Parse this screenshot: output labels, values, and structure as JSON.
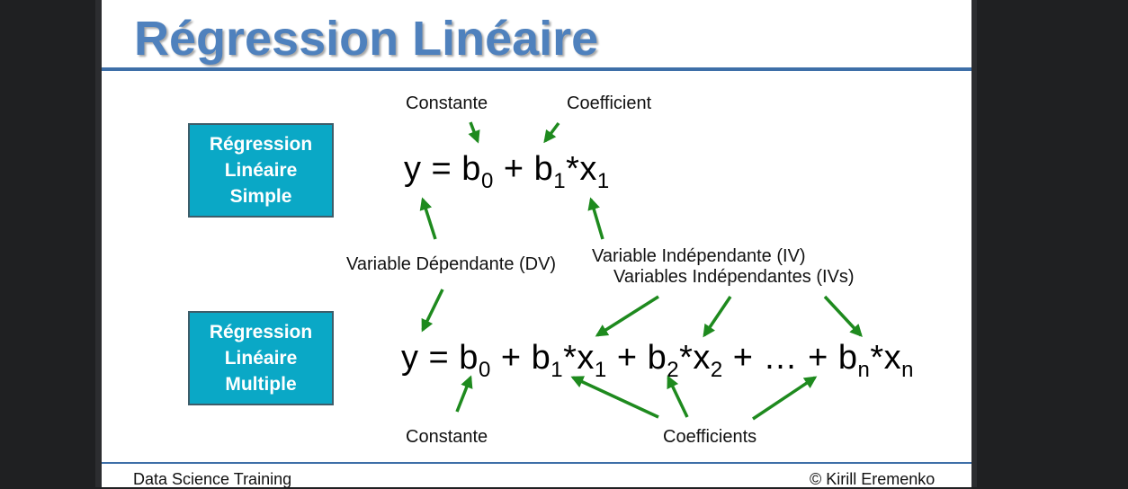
{
  "slide": {
    "title": "Régression Linéaire",
    "box_simple": [
      "Régression",
      "Linéaire",
      "Simple"
    ],
    "box_multiple": [
      "Régression",
      "Linéaire",
      "Multiple"
    ],
    "labels": {
      "constante_top": "Constante",
      "coefficient_top": "Coefficient",
      "dv": "Variable Dépendante (DV)",
      "iv": "Variable Indépendante (IV)",
      "ivs": "Variables Indépendantes (IVs)",
      "constante_bottom": "Constante",
      "coefficients_bottom": "Coefficients"
    },
    "footer_left": "Data Science Training",
    "footer_right": "© Kirill Eremenko",
    "colors": {
      "title": "#4f81bd",
      "box": "#0aa8c6",
      "arrow": "#1e8a1e",
      "rule": "#3e6fa8"
    }
  }
}
